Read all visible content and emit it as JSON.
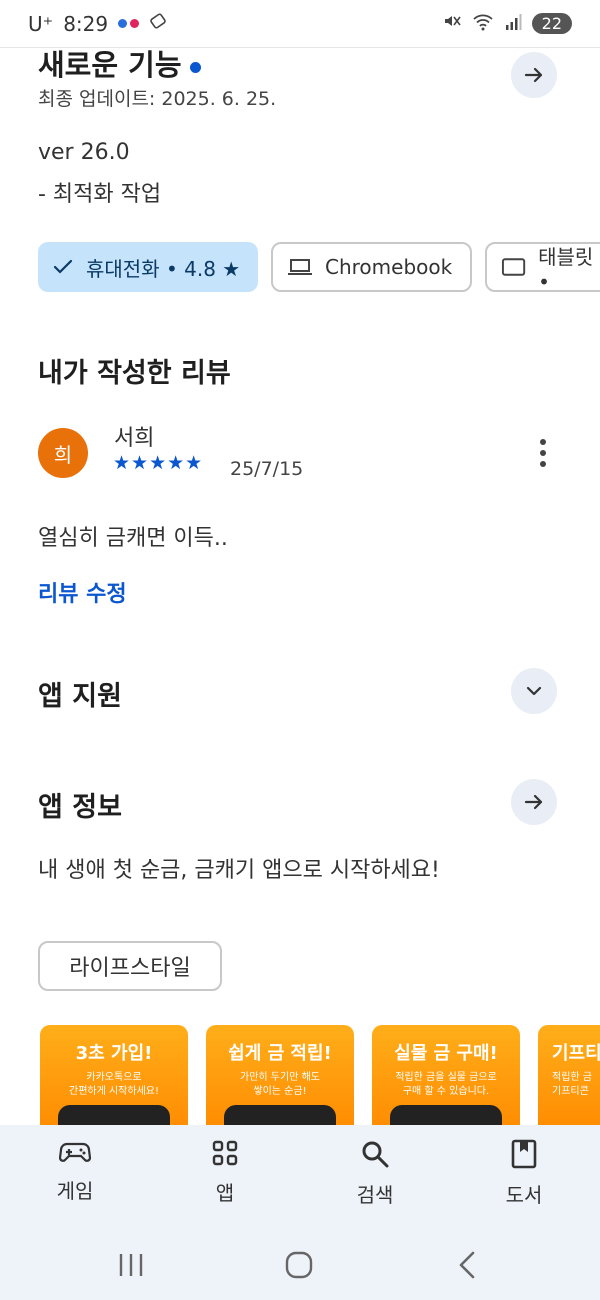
{
  "status_bar": {
    "carrier": "U⁺",
    "time": "8:29",
    "battery": "22"
  },
  "whats_new": {
    "title": "새로운 기능",
    "updated": "최종 업데이트: 2025. 6. 25.",
    "version": "ver 26.0",
    "note": "- 최적화 작업"
  },
  "device_chips": [
    {
      "label": "휴대전화 • 4.8 ★",
      "icon": "check-icon",
      "selected": true
    },
    {
      "label": "Chromebook",
      "icon": "laptop-icon",
      "selected": false
    },
    {
      "label": "태블릿 •",
      "icon": "tablet-icon",
      "selected": false
    }
  ],
  "my_review": {
    "title": "내가 작성한 리뷰",
    "avatar_initial": "희",
    "reviewer": "서희",
    "stars": "★★★★★",
    "rating": 5,
    "date": "25/7/15",
    "text": "열심히 금캐면 이득..",
    "edit_label": "리뷰 수정"
  },
  "app_support": {
    "title": "앱 지원"
  },
  "app_info": {
    "title": "앱 정보",
    "description": "내 생애 첫 순금, 금캐기 앱으로 시작하세요!",
    "category": "라이프스타일"
  },
  "screenshots": [
    {
      "headline": "3초 가입!",
      "sub1": "카카오톡으로",
      "sub2": "간편하게 시작하세요!"
    },
    {
      "headline": "쉽게 금 적립!",
      "sub1": "가만히 두기만 해도",
      "sub2": "쌓이는 순금!"
    },
    {
      "headline": "실물 금 구매!",
      "sub1": "적립한 금을 실물 금으로",
      "sub2": "구매 할 수 있습니다."
    },
    {
      "headline": "기프티",
      "sub1": "적립한 금",
      "sub2": "기프티콘"
    }
  ],
  "bottom_nav": [
    {
      "label": "게임",
      "icon": "gamepad-icon"
    },
    {
      "label": "앱",
      "icon": "apps-grid-icon"
    },
    {
      "label": "검색",
      "icon": "search-icon"
    },
    {
      "label": "도서",
      "icon": "book-icon"
    }
  ],
  "colors": {
    "accent": "#0b57d0",
    "chip_selected": "#c5e3fb",
    "avatar": "#e8710a",
    "nav_bg": "#eef2f9"
  }
}
